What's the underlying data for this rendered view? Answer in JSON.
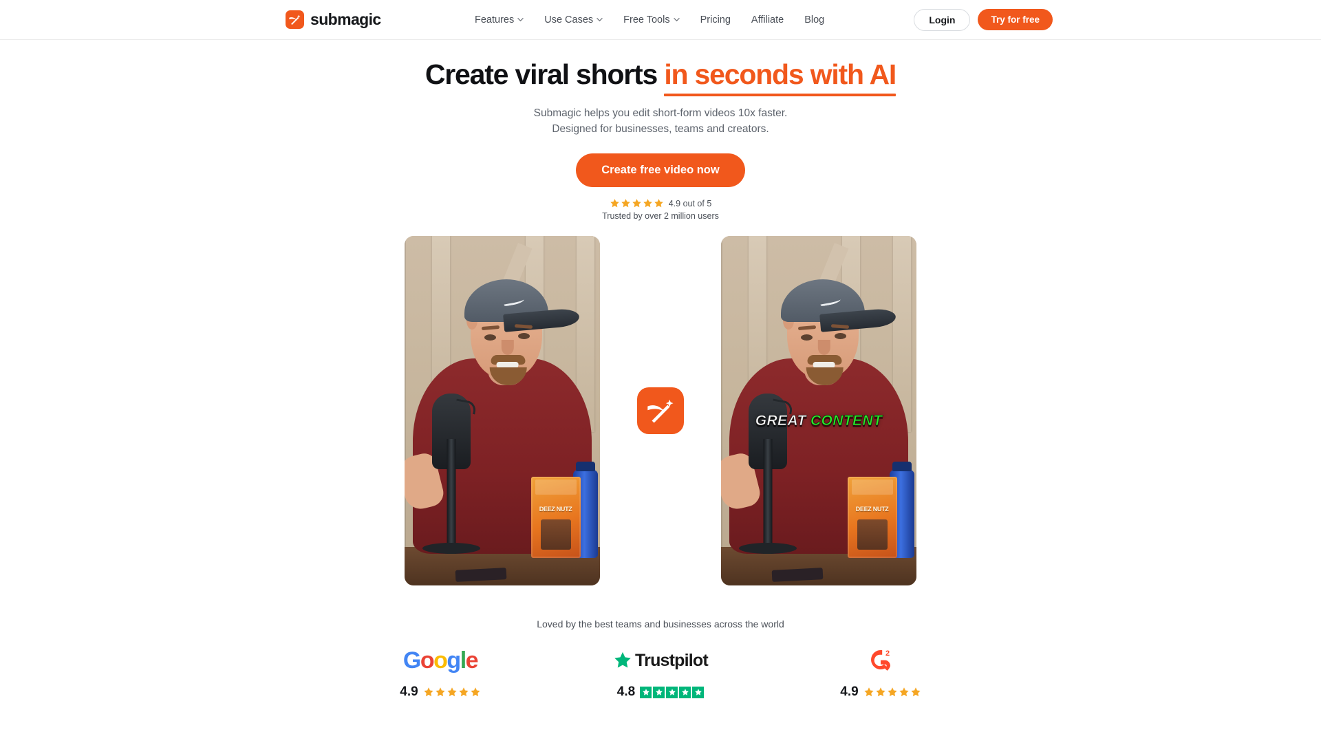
{
  "colors": {
    "brand_orange": "#F1581C",
    "star_gold": "#F5A623",
    "trustpilot_green": "#00B67A",
    "g2_red": "#FF492C",
    "caption_green": "#2BEC2B"
  },
  "header": {
    "brand_name": "submagic",
    "nav": [
      {
        "label": "Features",
        "has_dropdown": true
      },
      {
        "label": "Use Cases",
        "has_dropdown": true
      },
      {
        "label": "Free Tools",
        "has_dropdown": true
      },
      {
        "label": "Pricing",
        "has_dropdown": false
      },
      {
        "label": "Affiliate",
        "has_dropdown": false
      },
      {
        "label": "Blog",
        "has_dropdown": false
      }
    ],
    "login_label": "Login",
    "try_label": "Try for free"
  },
  "hero": {
    "headline_plain": "Create viral shorts ",
    "headline_accent": "in seconds with AI",
    "subhead_line1": "Submagic helps you edit short-form videos 10x faster.",
    "subhead_line2": "Designed for businesses, teams and creators.",
    "cta_label": "Create free video now",
    "rating_text": "4.9 out of 5",
    "rating_stars": 5,
    "trusted_text": "Trusted by over 2 million users"
  },
  "showcase": {
    "left_video_alt": "Original short-form video without captions",
    "right_video_alt": "Same video with auto-generated animated captions",
    "caption_word_1": "GREAT",
    "caption_word_2": "CONTENT",
    "product_box_text": "DEEZ NUTZ"
  },
  "trust": {
    "caption": "Loved by the best teams and businesses across the world",
    "badges": [
      {
        "name": "Google",
        "score": "4.9",
        "star_style": "gold-stars",
        "stars": 5
      },
      {
        "name": "Trustpilot",
        "score": "4.8",
        "star_style": "green-boxes",
        "stars": 5
      },
      {
        "name": "G2",
        "score": "4.9",
        "star_style": "gold-stars",
        "stars": 5
      }
    ],
    "google_letters": [
      {
        "ch": "G",
        "color": "#4285F4"
      },
      {
        "ch": "o",
        "color": "#EA4335"
      },
      {
        "ch": "o",
        "color": "#FBBC05"
      },
      {
        "ch": "g",
        "color": "#4285F4"
      },
      {
        "ch": "l",
        "color": "#34A853"
      },
      {
        "ch": "e",
        "color": "#EA4335"
      }
    ],
    "trustpilot_word": "Trustpilot",
    "g2_label": "G2"
  }
}
